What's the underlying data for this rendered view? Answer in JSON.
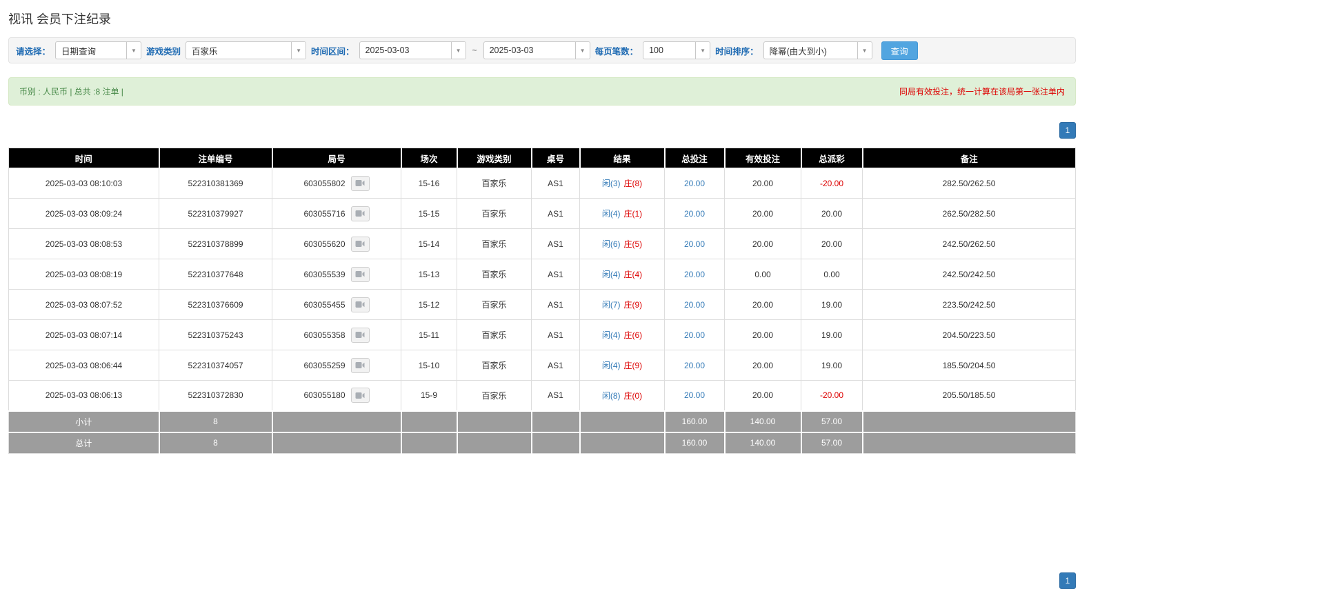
{
  "page": {
    "title": "视讯 会员下注纪录"
  },
  "filters": {
    "select_label": "请选择：",
    "select_value": "日期查询",
    "game_type_label": "游戏类别",
    "game_type_value": "百家乐",
    "date_range_label": "时间区间：",
    "date_from": "2025-03-03",
    "range_separator": "~",
    "date_to": "2025-03-03",
    "page_size_label": "每页笔数：",
    "page_size_value": "100",
    "sort_label": "时间排序：",
    "sort_value": "降幂(由大到小)",
    "search_button": "查询"
  },
  "summary": {
    "left": "币别 : 人民币 | 总共 :8 注单 |",
    "right": "同局有效投注，统一计算在该局第一张注单内"
  },
  "pagination": {
    "current_page": "1"
  },
  "colors": {
    "header_bg": "#000000",
    "footer_bg": "#9d9d9d",
    "link_blue": "#337ab7",
    "player_blue": "#337ab7",
    "banker_red": "#dd0000",
    "negative_red": "#dd0000",
    "query_button_blue": "#52a5e0",
    "pager_blue": "#337ab7",
    "summary_bg": "#dff0d8",
    "filter_label_blue": "#1f6bb3"
  },
  "table": {
    "headers": [
      "时间",
      "注单编号",
      "局号",
      "场次",
      "游戏类别",
      "桌号",
      "结果",
      "总投注",
      "有效投注",
      "总派彩",
      "备注"
    ],
    "rows": [
      {
        "time": "2025-03-03 08:10:03",
        "bet_id": "522310381369",
        "round_id": "603055802",
        "session": "15-16",
        "game": "百家乐",
        "table_no": "AS1",
        "result_player": "闲(3)",
        "result_banker": "庄(8)",
        "total_bet": "20.00",
        "valid_bet": "20.00",
        "payout": "-20.00",
        "remark": "282.50/262.50"
      },
      {
        "time": "2025-03-03 08:09:24",
        "bet_id": "522310379927",
        "round_id": "603055716",
        "session": "15-15",
        "game": "百家乐",
        "table_no": "AS1",
        "result_player": "闲(4)",
        "result_banker": "庄(1)",
        "total_bet": "20.00",
        "valid_bet": "20.00",
        "payout": "20.00",
        "remark": "262.50/282.50"
      },
      {
        "time": "2025-03-03 08:08:53",
        "bet_id": "522310378899",
        "round_id": "603055620",
        "session": "15-14",
        "game": "百家乐",
        "table_no": "AS1",
        "result_player": "闲(6)",
        "result_banker": "庄(5)",
        "total_bet": "20.00",
        "valid_bet": "20.00",
        "payout": "20.00",
        "remark": "242.50/262.50"
      },
      {
        "time": "2025-03-03 08:08:19",
        "bet_id": "522310377648",
        "round_id": "603055539",
        "session": "15-13",
        "game": "百家乐",
        "table_no": "AS1",
        "result_player": "闲(4)",
        "result_banker": "庄(4)",
        "total_bet": "20.00",
        "valid_bet": "0.00",
        "payout": "0.00",
        "remark": "242.50/242.50"
      },
      {
        "time": "2025-03-03 08:07:52",
        "bet_id": "522310376609",
        "round_id": "603055455",
        "session": "15-12",
        "game": "百家乐",
        "table_no": "AS1",
        "result_player": "闲(7)",
        "result_banker": "庄(9)",
        "total_bet": "20.00",
        "valid_bet": "20.00",
        "payout": "19.00",
        "remark": "223.50/242.50"
      },
      {
        "time": "2025-03-03 08:07:14",
        "bet_id": "522310375243",
        "round_id": "603055358",
        "session": "15-11",
        "game": "百家乐",
        "table_no": "AS1",
        "result_player": "闲(4)",
        "result_banker": "庄(6)",
        "total_bet": "20.00",
        "valid_bet": "20.00",
        "payout": "19.00",
        "remark": "204.50/223.50"
      },
      {
        "time": "2025-03-03 08:06:44",
        "bet_id": "522310374057",
        "round_id": "603055259",
        "session": "15-10",
        "game": "百家乐",
        "table_no": "AS1",
        "result_player": "闲(4)",
        "result_banker": "庄(9)",
        "total_bet": "20.00",
        "valid_bet": "20.00",
        "payout": "19.00",
        "remark": "185.50/204.50"
      },
      {
        "time": "2025-03-03 08:06:13",
        "bet_id": "522310372830",
        "round_id": "603055180",
        "session": "15-9",
        "game": "百家乐",
        "table_no": "AS1",
        "result_player": "闲(8)",
        "result_banker": "庄(0)",
        "total_bet": "20.00",
        "valid_bet": "20.00",
        "payout": "-20.00",
        "remark": "205.50/185.50"
      }
    ],
    "subtotal": {
      "label": "小计",
      "count": "8",
      "total_bet": "160.00",
      "valid_bet": "140.00",
      "payout": "57.00"
    },
    "total": {
      "label": "总计",
      "count": "8",
      "total_bet": "160.00",
      "valid_bet": "140.00",
      "payout": "57.00"
    }
  }
}
